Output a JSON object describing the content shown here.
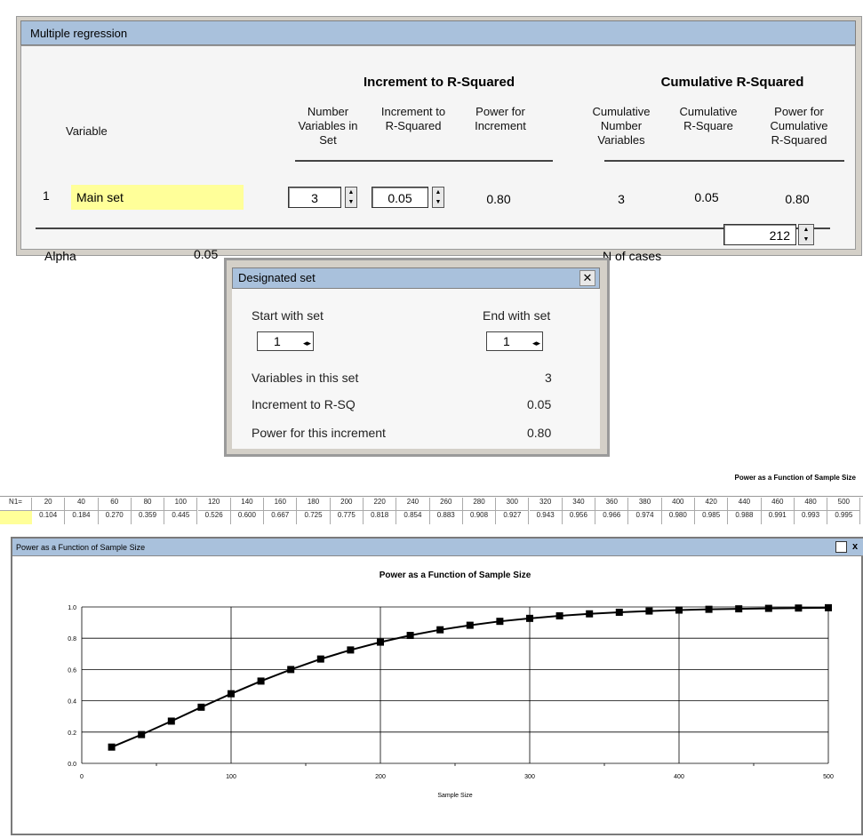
{
  "regression": {
    "title": "Multiple regression",
    "group_increment": "Increment to R-Squared",
    "group_cumulative": "Cumulative R-Squared",
    "col_variable": "Variable",
    "col_num_vars": [
      "Number",
      "Variables in",
      "Set"
    ],
    "col_increment": [
      "Increment to",
      "R-Squared"
    ],
    "col_power_inc": [
      "Power for",
      "Increment"
    ],
    "col_cum_num": [
      "Cumulative",
      "Number",
      "Variables"
    ],
    "col_cum_rsq": [
      "Cumulative",
      "R-Square"
    ],
    "col_power_cum": [
      "Power for",
      "Cumulative",
      "R-Squared"
    ],
    "row": {
      "index": "1",
      "name": "Main set",
      "num_vars": "3",
      "increment": "0.05",
      "power_inc": "0.80",
      "cum_num": "3",
      "cum_rsq": "0.05",
      "power_cum": "0.80"
    },
    "alpha_label": "Alpha",
    "alpha_value": "0.05",
    "n_label": "N of cases",
    "n_value": "212"
  },
  "designated": {
    "title": "Designated set",
    "close": "✕",
    "start_label": "Start with set",
    "start_value": "1",
    "end_label": "End with set",
    "end_value": "1",
    "vars_label": "Variables in this set",
    "vars_value": "3",
    "inc_label": "Increment to R-SQ",
    "inc_value": "0.05",
    "power_label": "Power for this increment",
    "power_value": "0.80"
  },
  "table": {
    "title": "Power as a Function of Sample Size",
    "row_label": "N1=",
    "n": [
      "20",
      "40",
      "60",
      "80",
      "100",
      "120",
      "140",
      "160",
      "180",
      "200",
      "220",
      "240",
      "260",
      "280",
      "300",
      "320",
      "340",
      "360",
      "380",
      "400",
      "420",
      "440",
      "460",
      "480",
      "500"
    ],
    "power": [
      "0.104",
      "0.184",
      "0.270",
      "0.359",
      "0.445",
      "0.526",
      "0.600",
      "0.667",
      "0.725",
      "0.775",
      "0.818",
      "0.854",
      "0.883",
      "0.908",
      "0.927",
      "0.943",
      "0.956",
      "0.966",
      "0.974",
      "0.980",
      "0.985",
      "0.988",
      "0.991",
      "0.993",
      "0.995"
    ]
  },
  "chart_window": {
    "title": "Power as a Function of Sample Size",
    "close": "x"
  },
  "chart_data": {
    "type": "line",
    "title": "Power as a Function of Sample Size",
    "xlabel": "Sample Size",
    "ylabel": "",
    "xlim": [
      0,
      500
    ],
    "ylim": [
      0,
      1.0
    ],
    "x_ticks": [
      "0",
      "100",
      "200",
      "300",
      "400",
      "500"
    ],
    "y_ticks": [
      "0.0",
      "0.2",
      "0.4",
      "0.6",
      "0.8",
      "1.0"
    ],
    "grid": true,
    "series": [
      {
        "x": [
          20,
          40,
          60,
          80,
          100,
          120,
          140,
          160,
          180,
          200,
          220,
          240,
          260,
          280,
          300,
          320,
          340,
          360,
          380,
          400,
          420,
          440,
          460,
          480,
          500
        ],
        "values": [
          0.104,
          0.184,
          0.27,
          0.359,
          0.445,
          0.526,
          0.6,
          0.667,
          0.725,
          0.775,
          0.818,
          0.854,
          0.883,
          0.908,
          0.927,
          0.943,
          0.956,
          0.966,
          0.974,
          0.98,
          0.985,
          0.988,
          0.991,
          0.993,
          0.995
        ]
      }
    ]
  }
}
